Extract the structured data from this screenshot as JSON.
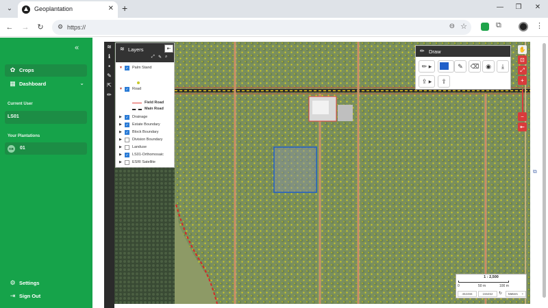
{
  "browser": {
    "tab_title": "Geoplantation",
    "url": "https://",
    "new_tab": "+",
    "close": "✕"
  },
  "sidebar": {
    "nav": [
      {
        "label": "Crops",
        "icon": "sprout-icon"
      },
      {
        "label": "Dashboard",
        "icon": "dashboard-icon"
      }
    ],
    "current_user_heading": "Current User",
    "current_user": "LS01",
    "plantations_heading": "Your Plantations",
    "plantations": [
      {
        "initials": "KB",
        "label": "01"
      }
    ],
    "bottom": [
      {
        "label": "Settings",
        "icon": "gear-icon"
      },
      {
        "label": "Sign Out",
        "icon": "sign-out-icon"
      }
    ]
  },
  "layers": {
    "title": "Layers",
    "items": [
      {
        "name": "Palm Stand",
        "checked": true,
        "expanded": true
      },
      {
        "name": "Road",
        "checked": true,
        "expanded": true
      },
      {
        "name": "Drainage",
        "checked": true,
        "expanded": false
      },
      {
        "name": "Estate Boundary",
        "checked": true,
        "expanded": false
      },
      {
        "name": "Block Boundary",
        "checked": true,
        "expanded": false
      },
      {
        "name": "Division Boundary",
        "checked": false,
        "expanded": false
      },
      {
        "name": "Landuse",
        "checked": false,
        "expanded": false
      },
      {
        "name": "LS01-Orthomosaic",
        "checked": true,
        "expanded": false
      },
      {
        "name": "ESRI Satellite",
        "checked": false,
        "expanded": false
      }
    ],
    "road_legend": [
      {
        "label": "Field Road",
        "color": "#e0403a"
      },
      {
        "label": "Main Road",
        "color": "#222222"
      }
    ]
  },
  "draw": {
    "title": "Draw",
    "fill_color": "#1f5fc9"
  },
  "scale": {
    "ratio": "1 : 2,500",
    "ticks": [
      "0",
      "50 m",
      "100 m"
    ],
    "coord_x": "452466",
    "coord_y": "156452",
    "unit": "Meters"
  },
  "colors": {
    "sidebar": "#16a34a",
    "sidebar_active": "#1c8d45",
    "road_main_stripe": "#f2d21b",
    "road_field": "#e0403a",
    "palm_dot": "#d9d21c",
    "boundary_dash": "#d62828"
  }
}
